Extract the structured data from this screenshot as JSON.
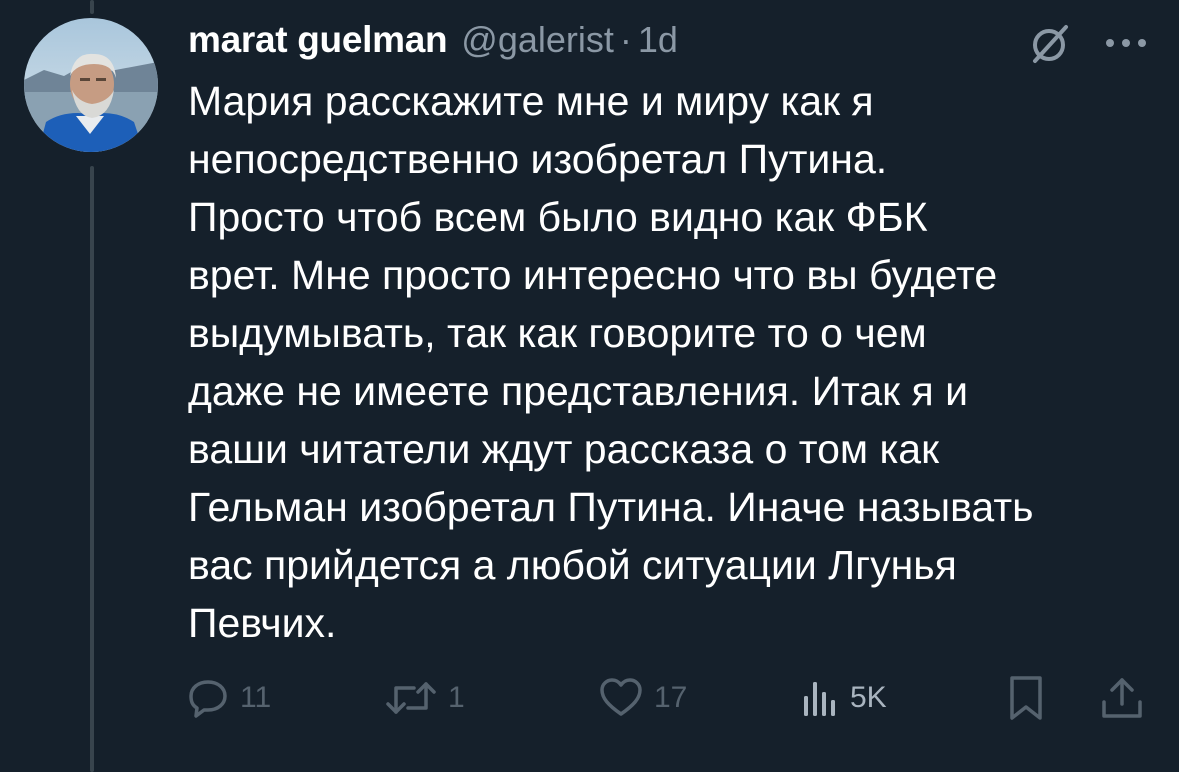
{
  "tweet": {
    "author": {
      "display_name": "marat guelman",
      "handle": "@galerist",
      "separator": "·",
      "time": "1d"
    },
    "text": "Мария расскажите мне и миру как я\nнепосредственно изобретал Путина.\nПросто чтоб всем было видно как ФБК\nврет. Мне просто интересно что вы будете\nвыдумывать, так как говорите то о чем\nдаже не имеете представления. Итак я и\nваши читатели ждут рассказа о том как\nГельман изобретал Путина. Иначе называть\nвас прийдется а любой ситуации Лгунья\nПевчих.",
    "icons": {
      "grok": "grok-slash-icon",
      "more": "more-dots-icon"
    },
    "actions": {
      "replies": {
        "icon": "reply-icon",
        "count": "11"
      },
      "retweets": {
        "icon": "retweet-icon",
        "count": "1"
      },
      "likes": {
        "icon": "heart-icon",
        "count": "17"
      },
      "views": {
        "icon": "views-bar-icon",
        "count": "5K"
      },
      "bookmark": {
        "icon": "bookmark-icon"
      },
      "share": {
        "icon": "share-icon"
      }
    }
  },
  "colors": {
    "background": "#15202b",
    "primary_text": "#ffffff",
    "secondary_text": "#8b98a5",
    "thread_line": "#38444d"
  }
}
